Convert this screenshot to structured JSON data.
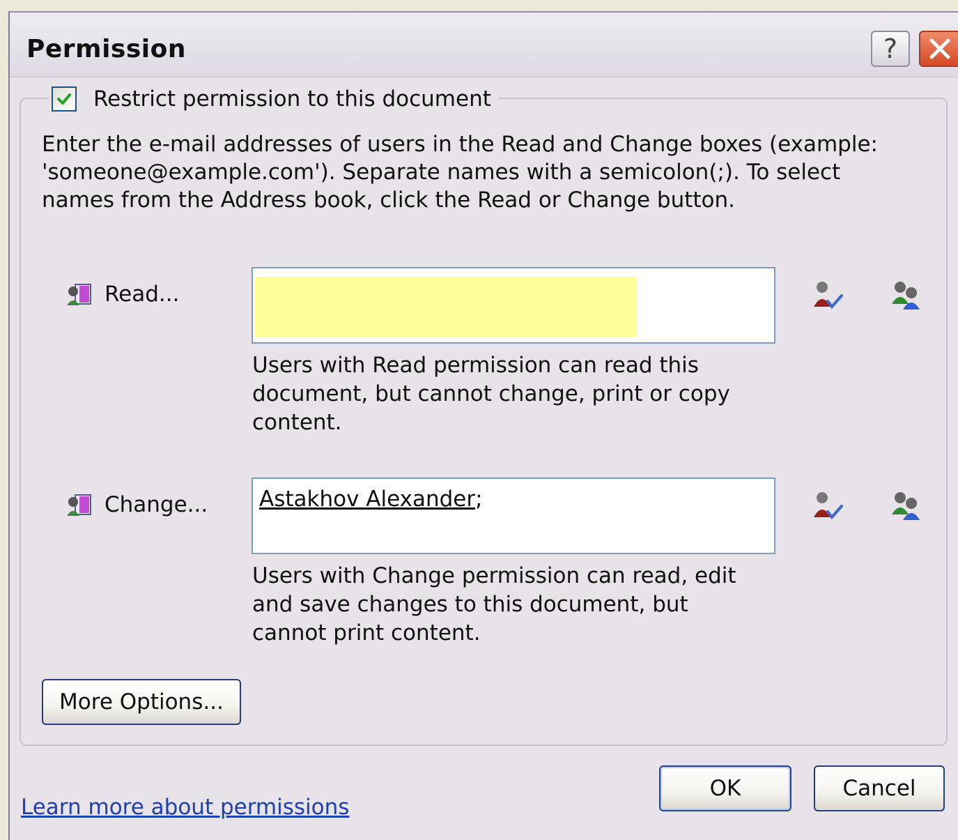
{
  "dialog": {
    "title": "Permission",
    "help_button": "?",
    "close_button": "✕"
  },
  "restrict": {
    "label": "Restrict permission to this document",
    "checked": true
  },
  "intro_text": "Enter the e-mail addresses of users in the Read and Change boxes (example: 'someone@example.com'). Separate names with a semicolon(;). To select names from the Address book, click the Read or Change button.",
  "read": {
    "label": "Read...",
    "value": "",
    "help": "Users with Read permission can read this document, but cannot change, print or copy content."
  },
  "change": {
    "label": "Change...",
    "value_name": "Astakhov Alexander",
    "value_sep": ";",
    "help": "Users with Change permission can read, edit and save changes to this document, but cannot print content."
  },
  "buttons": {
    "more_options": "More Options...",
    "ok": "OK",
    "cancel": "Cancel"
  },
  "learn_link": "Learn more about permissions",
  "icons": {
    "address_book": "address-book-icon",
    "check_names": "check-names-icon",
    "select_users": "select-users-icon"
  },
  "colors": {
    "dialog_bg": "#e8e2e9",
    "highlight": "#ffff99",
    "link": "#1d3fb0",
    "close_red": "#d64a28"
  }
}
